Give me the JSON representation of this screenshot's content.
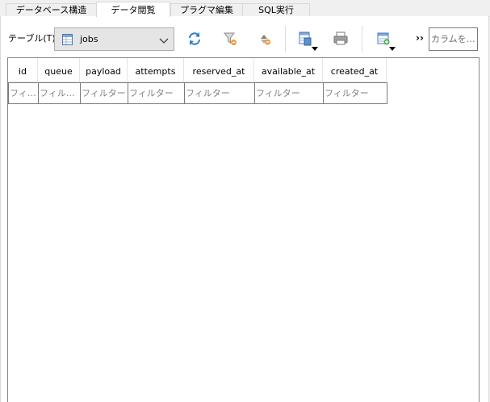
{
  "tabs": [
    {
      "label": "データベース構造",
      "active": false
    },
    {
      "label": "データ閲覧",
      "active": true
    },
    {
      "label": "プラグマ編集",
      "active": false
    },
    {
      "label": "SQL実行",
      "active": false
    }
  ],
  "toolbar": {
    "table_label": "テーブル(T):",
    "table_value": "jobs",
    "overflow_label": "››",
    "column_search_placeholder": "カラムを…",
    "icons": [
      "refresh-icon",
      "clear-filters-icon",
      "clear-sorting-icon",
      "save-results-icon",
      "print-icon",
      "insert-record-icon"
    ]
  },
  "grid": {
    "columns": [
      "id",
      "queue",
      "payload",
      "attempts",
      "reserved_at",
      "available_at",
      "created_at"
    ],
    "filter_placeholders": [
      "フィ…",
      "フィル…",
      "フィルター",
      "フィルター",
      "フィルター",
      "フィルター",
      "フィルター"
    ]
  },
  "colors": {
    "accent": "#0078d7",
    "grid_border": "#828790",
    "panel_bg": "#ffffff",
    "window_bg": "#f0f0f0"
  }
}
